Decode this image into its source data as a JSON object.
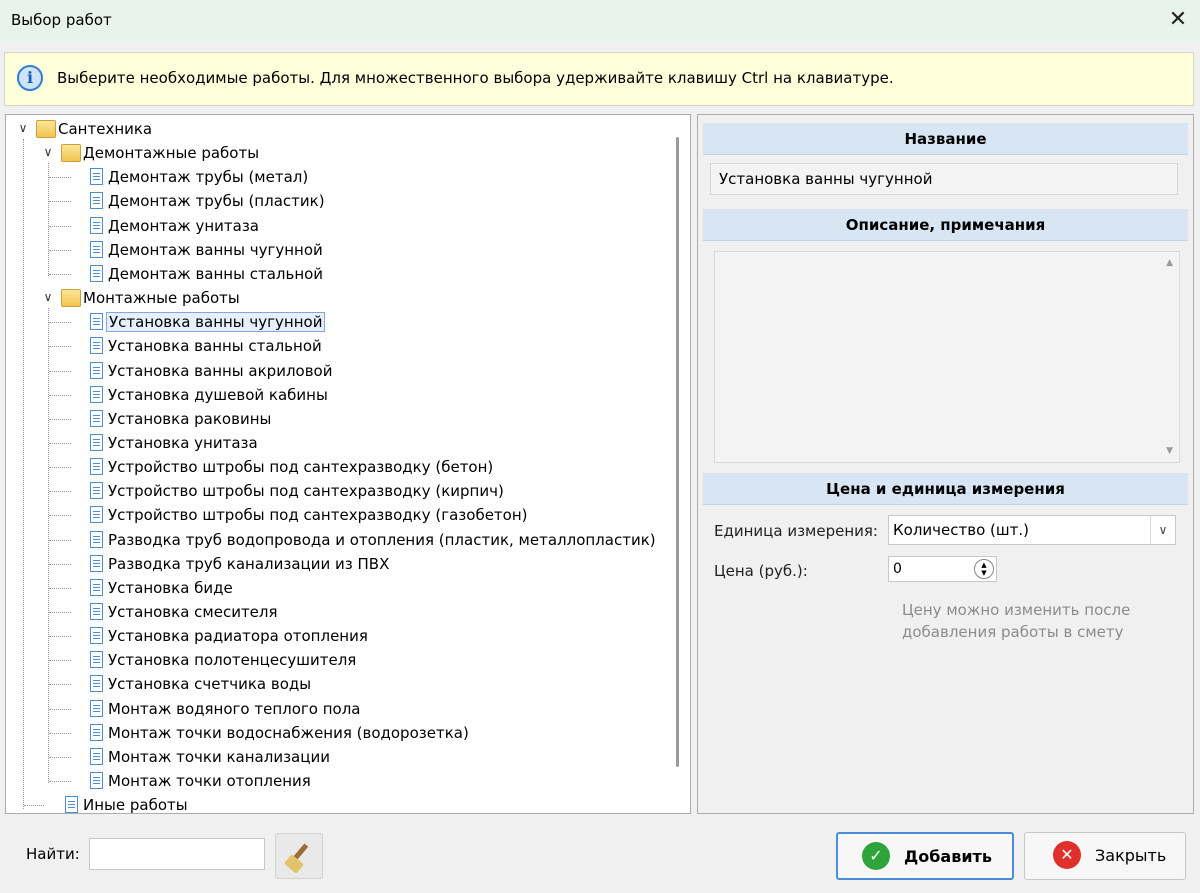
{
  "window": {
    "title": "Выбор работ",
    "close_glyph": "✕"
  },
  "info": {
    "icon": "info-icon",
    "message": "Выберите необходимые работы. Для множественного выбора удерживайте клавишу Ctrl на клавиатуре."
  },
  "tree": {
    "root": "Сантехника",
    "demontazh": {
      "label": "Демонтажные работы",
      "items": [
        "Демонтаж трубы (метал)",
        "Демонтаж трубы (пластик)",
        "Демонтаж унитаза",
        "Демонтаж ванны чугунной",
        "Демонтаж ванны стальной"
      ]
    },
    "montazh": {
      "label": "Монтажные работы",
      "items": [
        "Установка ванны чугунной",
        "Установка ванны стальной",
        "Установка ванны акриловой",
        "Установка душевой кабины",
        "Установка раковины",
        "Установка унитаза",
        "Устройство штробы под сантехразводку (бетон)",
        "Устройство штробы под сантехразводку (кирпич)",
        "Устройство штробы под сантехразводку (газобетон)",
        "Разводка труб водопровода и отопления (пластик, металлопластик)",
        "Разводка труб канализации из ПВХ",
        "Установка биде",
        "Установка смесителя",
        "Установка радиатора отопления",
        "Установка полотенцесушителя",
        "Установка счетчика воды",
        "Монтаж водяного теплого пола",
        "Монтаж точки водоснабжения (водорозетка)",
        "Монтаж точки канализации",
        "Монтаж точки отопления"
      ]
    },
    "other": "Иные работы",
    "selected": "Установка ванны чугунной"
  },
  "details": {
    "name_header": "Название",
    "name_value": "Установка ванны чугунной",
    "desc_header": "Описание, примечания",
    "desc_value": "",
    "price_header": "Цена и единица измерения",
    "unit_label": "Единица измерения:",
    "unit_value": "Количество (шт.)",
    "price_label": "Цена (руб.):",
    "price_value": "0",
    "hint_line1": "Цену можно изменить после",
    "hint_line2": "добавления работы в смету"
  },
  "footer": {
    "find_label": "Найти:",
    "find_value": "",
    "add_label": "Добавить",
    "close_label": "Закрыть"
  },
  "colors": {
    "accent": "#4a8fd6",
    "header_bg": "#d8e6f3",
    "info_bg": "#ffffdc",
    "add_icon": "#2fa43a",
    "close_icon": "#e0302b"
  }
}
